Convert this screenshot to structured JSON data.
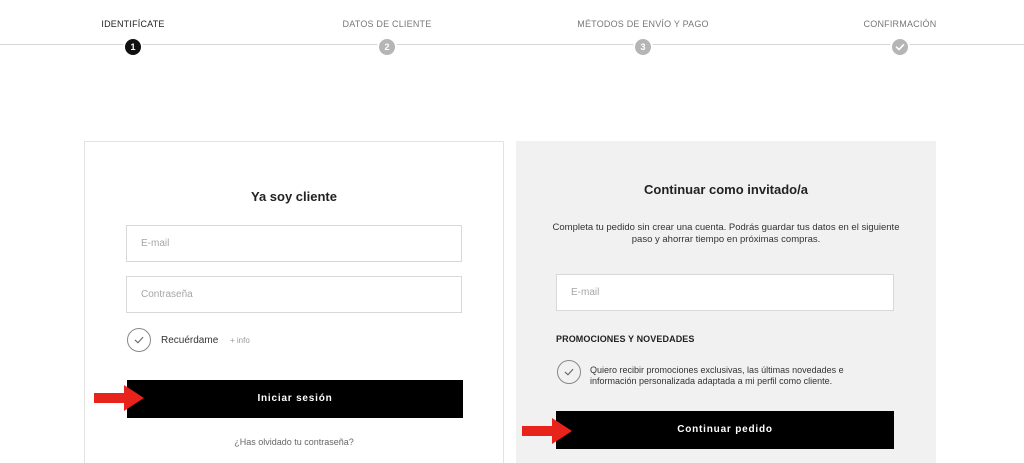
{
  "stepper": {
    "steps": [
      {
        "label": "IDENTIFÍCATE",
        "number": "1",
        "state": "active"
      },
      {
        "label": "DATOS DE CLIENTE",
        "number": "2",
        "state": "pending"
      },
      {
        "label": "MÉTODOS DE ENVÍO Y PAGO",
        "number": "3",
        "state": "pending"
      },
      {
        "label": "CONFIRMACIÓN",
        "number": "",
        "state": "check"
      }
    ]
  },
  "login": {
    "title": "Ya soy cliente",
    "email_placeholder": "E-mail",
    "password_placeholder": "Contraseña",
    "remember_label": "Recuérdame",
    "remember_info": "+ info",
    "submit_label": "Iniciar sesión",
    "forgot_label": "¿Has olvidado tu contraseña?"
  },
  "guest": {
    "title": "Continuar como invitado/a",
    "description": "Completa tu pedido sin crear una cuenta. Podrás guardar tus datos en el siguiente paso y ahorrar tiempo en próximas compras.",
    "email_placeholder": "E-mail",
    "promo_title": "PROMOCIONES Y NOVEDADES",
    "promo_text": "Quiero recibir promociones exclusivas, las últimas novedades e información personalizada adaptada a mi perfil como cliente.",
    "submit_label": "Continuar pedido"
  },
  "colors": {
    "accent": "#000000",
    "annotation_arrow": "#e8231b",
    "guest_panel_bg": "#f1f1f1"
  },
  "icons": {
    "step_check": "check-icon",
    "checkbox": "check-icon",
    "annotation": "red-arrow-icon"
  }
}
